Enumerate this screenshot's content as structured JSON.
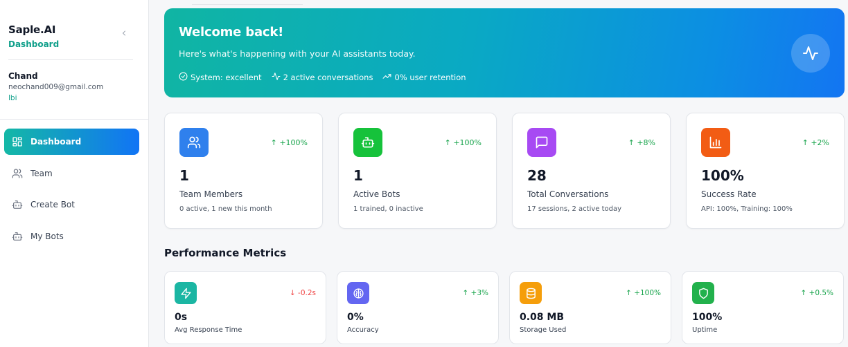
{
  "sidebar": {
    "brand": "Saple.AI",
    "brand_sub": "Dashboard",
    "collapse_icon": "chevron-left-icon",
    "user": {
      "name": "Chand",
      "email": "neochand009@gmail.com",
      "org": "lbi"
    },
    "nav": [
      {
        "label": "Dashboard",
        "icon": "grid-icon",
        "active": true
      },
      {
        "label": "Team",
        "icon": "users-icon",
        "active": false
      },
      {
        "label": "Create Bot",
        "icon": "bot-icon",
        "active": false
      },
      {
        "label": "My Bots",
        "icon": "bot-icon",
        "active": false
      }
    ]
  },
  "banner": {
    "title": "Welcome back!",
    "subtitle": "Here's what's happening with your AI assistants today.",
    "stats": [
      {
        "icon": "check-circle-icon",
        "text": "System: excellent"
      },
      {
        "icon": "activity-icon",
        "text": "2 active conversations"
      },
      {
        "icon": "trending-up-icon",
        "text": "0% user retention"
      }
    ],
    "badge_icon": "activity-icon"
  },
  "cards": [
    {
      "icon": "users-icon",
      "color": "#2f80ed",
      "trend": "↑ +100%",
      "value": "1",
      "label": "Team Members",
      "detail": "0 active, 1 new this month"
    },
    {
      "icon": "bot-icon",
      "color": "#16c23b",
      "trend": "↑ +100%",
      "value": "1",
      "label": "Active Bots",
      "detail": "1 trained, 0 inactive"
    },
    {
      "icon": "message-icon",
      "color": "#a74af3",
      "trend": "↑ +8%",
      "value": "28",
      "label": "Total Conversations",
      "detail": "17 sessions, 2 active today"
    },
    {
      "icon": "bar-chart-icon",
      "color": "#f25c14",
      "trend": "↑ +2%",
      "value": "100%",
      "label": "Success Rate",
      "detail": "API: 100%, Training: 100%"
    }
  ],
  "performance": {
    "title": "Performance Metrics",
    "metrics": [
      {
        "icon": "zap-icon",
        "color": "#1bb6a3",
        "trend": "↓ -0.2s",
        "trend_color": "#ef4444",
        "value": "0s",
        "label": "Avg Response Time"
      },
      {
        "icon": "brain-icon",
        "color": "#6366f1",
        "trend": "↑ +3%",
        "trend_color": "#16a34a",
        "value": "0%",
        "label": "Accuracy"
      },
      {
        "icon": "database-icon",
        "color": "#f59e0b",
        "trend": "↑ +100%",
        "trend_color": "#16a34a",
        "value": "0.08 MB",
        "label": "Storage Used"
      },
      {
        "icon": "shield-icon",
        "color": "#22b14c",
        "trend": "↑ +0.5%",
        "trend_color": "#16a34a",
        "value": "100%",
        "label": "Uptime"
      }
    ]
  }
}
